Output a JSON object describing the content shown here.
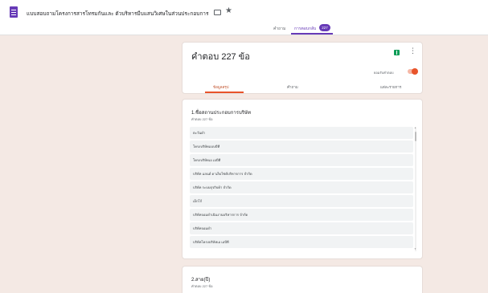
{
  "header": {
    "doc_title": "แบบสอบถามโครงการสารโทรมกันและ ตัวบริหารมีบแสนวิเศษในส่วนประกอบการ",
    "folder_icon": "folder-icon",
    "star_icon": "star-icon",
    "tabs": [
      {
        "label": "คำถาม"
      },
      {
        "label": "การตอบกลับ",
        "badge": "227"
      }
    ],
    "accent_color": "#673ab7"
  },
  "responses_card": {
    "count_title": "คำตอบ 227 ข้อ",
    "sheets_icon": "sheets-icon",
    "more_icon": "more-vert-icon",
    "accepting_label": "ยอมรับคำตอบ",
    "accepting_on": true,
    "sub_tabs": [
      {
        "label": "ข้อมูลสรุป"
      },
      {
        "label": "คำถาม"
      },
      {
        "label": "แต่ละรายการ"
      }
    ],
    "accent_color": "#e8542b"
  },
  "question1": {
    "title": "1.ชื่อสถานประกอบการบริษัท",
    "count": "คำตอบ 227 ข้อ",
    "responses": [
      "ตะวันดำ",
      "โครงบริษัทแบบบีที",
      "โครงบริษัทเอ เอบีที",
      "บริษัท แลนด์ ดาเล็บไซต์บริหารการ จำกัด",
      "บริษัท ระบบธุรกิจค้า จำกัด",
      "เอ็กโก้",
      "บริษัทจอมดำเนินงานบริหารการ จำกัด",
      "บริษัทจอมดำ",
      "บริษัทโครงบริษัทเอ เอบีที"
    ]
  },
  "question2": {
    "title": "2.สาย(ปี)",
    "count": "คำตอบ 227 ข้อ"
  }
}
